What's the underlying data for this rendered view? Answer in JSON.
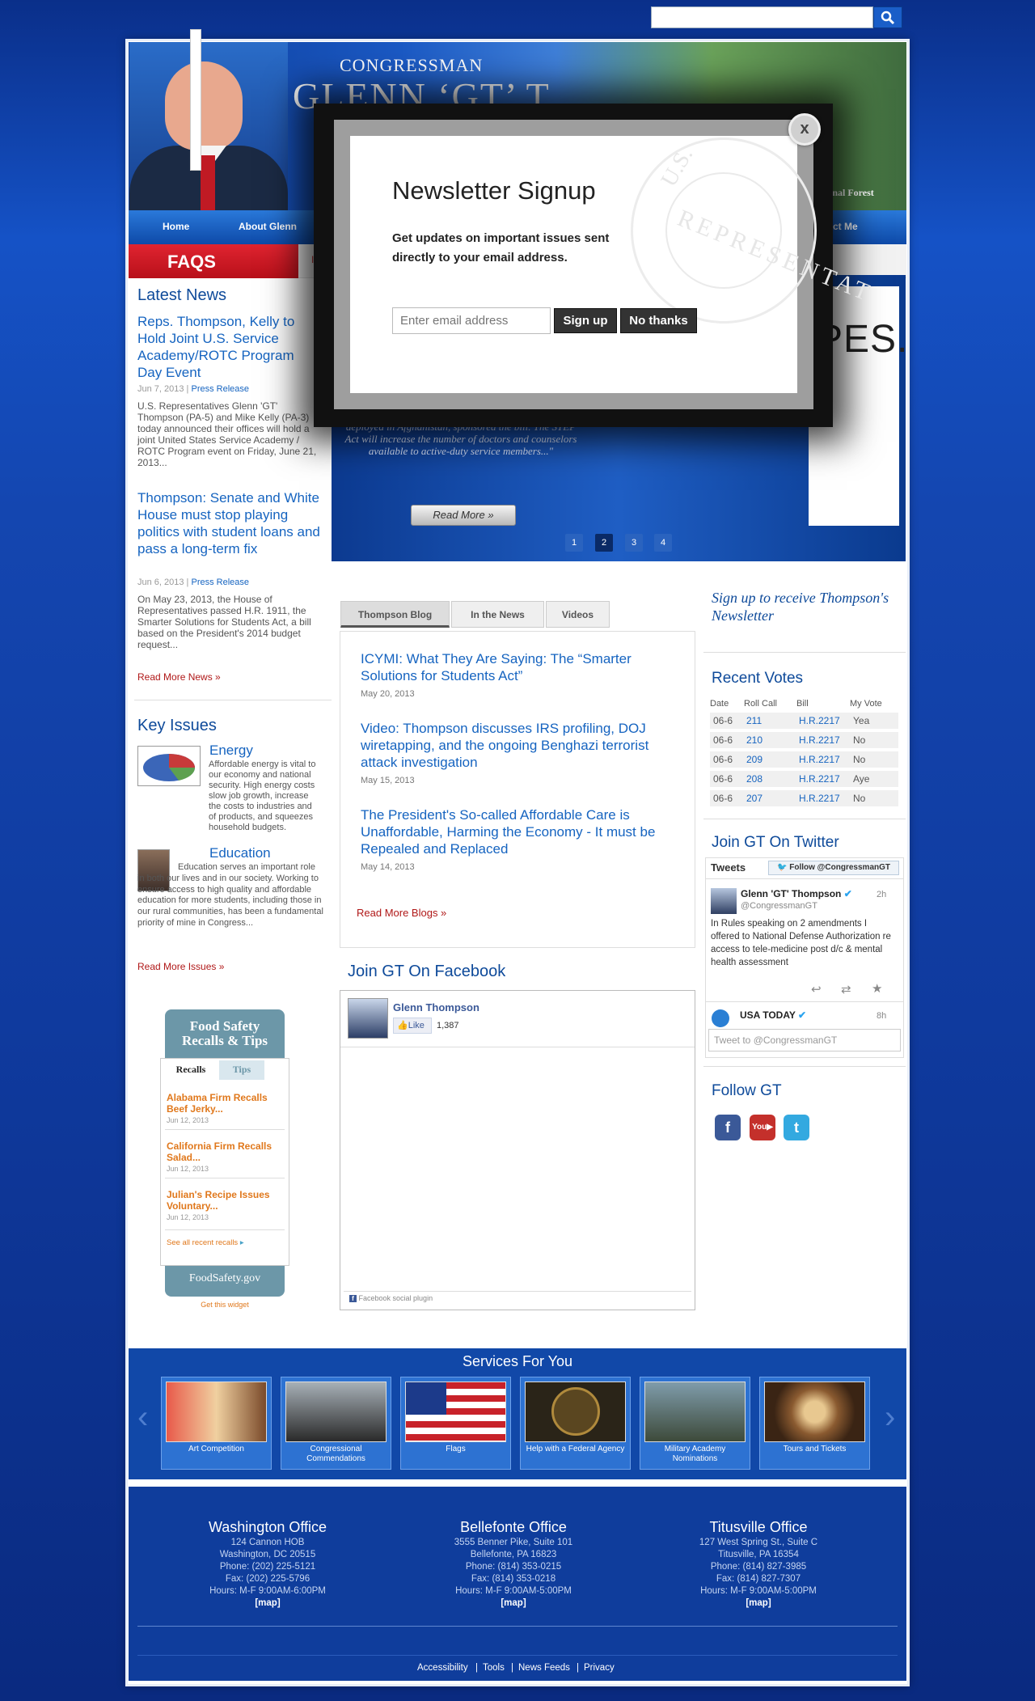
{
  "search": {
    "placeholder": ""
  },
  "header": {
    "title_small": "CONGRESSMAN",
    "title_big": "GLENN ‘GT’ T",
    "forest_caption": "ational Forest",
    "nav": [
      "Home",
      "About Glenn",
      "ntact Me"
    ],
    "faqs": "FAQS",
    "faqs_partial": "Int"
  },
  "latest_news": {
    "heading": "Latest News",
    "items": [
      {
        "title": "Reps. Thompson, Kelly to Hold Joint U.S. Service Academy/ROTC Program Day Event",
        "date": "Jun 7, 2013",
        "category": "Press Release",
        "snippet": "U.S. Representatives Glenn 'GT' Thompson (PA-5) and Mike Kelly (PA-3) today announced their offices will hold a joint United States Service Academy / ROTC Program event on Friday, June 21, 2013..."
      },
      {
        "title": "Thompson: Senate and White House must stop playing politics with student loans and pass a long-term fix",
        "date": "Jun 6, 2013",
        "category": "Press Release",
        "snippet": "On May 23, 2013, the House of Representatives passed H.R. 1911, the Smarter Solutions for Students Act, a bill based on the President's 2014 budget request..."
      }
    ],
    "more": "Read More News »"
  },
  "key_issues": {
    "heading": "Key Issues",
    "items": [
      {
        "title": "Energy",
        "text": "Affordable energy is vital to our economy and national security. High energy costs slow job growth, increase the costs to industries and of products, and squeezes household budgets."
      },
      {
        "title": "Education",
        "text": "Education serves an important role in both our lives and in our society. Working to ensure access to high quality and affordable education for more students, including those in our rural communities, has been a fundamental priority of mine in Congress..."
      }
    ],
    "more": "Read More Issues »"
  },
  "food_safety": {
    "title": "Food Safety Recalls & Tips",
    "tabs": [
      "Recalls",
      "Tips"
    ],
    "items": [
      {
        "title": "Alabama Firm Recalls Beef Jerky...",
        "date": "Jun 12, 2013"
      },
      {
        "title": "California Firm Recalls Salad...",
        "date": "Jun 12, 2013"
      },
      {
        "title": "Julian's Recipe Issues Voluntary...",
        "date": "Jun 12, 2013"
      }
    ],
    "see_all": "See all recent recalls",
    "footer": "FoodSafety.gov",
    "get_widget": "Get this widget"
  },
  "slider": {
    "partial_text": "PES.",
    "quote": "Thompson, R-Pa., father of an Army staff sergeant deployed in Afghanistan, sponsored the bill. The STEP Act will increase the number of doctors and counselors available to active-duty service members...\"",
    "read_more": "Read More »",
    "pages": [
      "1",
      "2",
      "3",
      "4"
    ],
    "active_page": 2
  },
  "blog": {
    "tabs": [
      "Thompson Blog",
      "In the News",
      "Videos"
    ],
    "items": [
      {
        "title": "ICYMI: What They Are Saying: The “Smarter Solutions for Students Act”",
        "date": "May 20, 2013"
      },
      {
        "title": "Video: Thompson discusses IRS profiling, DOJ wiretapping, and the ongoing Benghazi terrorist attack investigation",
        "date": "May 15, 2013"
      },
      {
        "title": "The President's So-called Affordable Care is Unaffordable, Harming the Economy - It must be Repealed and Replaced",
        "date": "May 14, 2013"
      }
    ],
    "more": "Read More Blogs »"
  },
  "facebook": {
    "heading": "Join GT On Facebook",
    "name": "Glenn Thompson",
    "like": "Like",
    "count": "1,387",
    "plugin": "Facebook social plugin"
  },
  "right": {
    "newsletter": "Sign up to receive Thompson's Newsletter",
    "votes_heading": "Recent Votes",
    "votes_cols": [
      "Date",
      "Roll Call",
      "Bill",
      "My Vote"
    ],
    "votes": [
      {
        "date": "06-6",
        "roll": "211",
        "bill": "H.R.2217",
        "vote": "Yea"
      },
      {
        "date": "06-6",
        "roll": "210",
        "bill": "H.R.2217",
        "vote": "No"
      },
      {
        "date": "06-6",
        "roll": "209",
        "bill": "H.R.2217",
        "vote": "No"
      },
      {
        "date": "06-6",
        "roll": "208",
        "bill": "H.R.2217",
        "vote": "Aye"
      },
      {
        "date": "06-6",
        "roll": "207",
        "bill": "H.R.2217",
        "vote": "No"
      }
    ],
    "twitter_heading": "Join GT On Twitter",
    "tweets_label": "Tweets",
    "follow": "Follow @CongressmanGT",
    "tweet1": {
      "name": "Glenn 'GT' Thompson",
      "handle": "@CongressmanGT",
      "time": "2h",
      "text": "In Rules speaking on 2 amendments I offered to National Defense Authorization re access to tele-medicine post d/c & mental health assessment"
    },
    "tweet2": {
      "name": "USA TODAY",
      "time": "8h"
    },
    "tweet_placeholder": "Tweet to @CongressmanGT",
    "follow_heading": "Follow GT",
    "social": [
      "facebook-icon",
      "youtube-icon",
      "twitter-icon"
    ]
  },
  "services": {
    "heading": "Services For You",
    "items": [
      "Art Competition",
      "Congressional Commendations",
      "Flags",
      "Help with a Federal Agency",
      "Military Academy Nominations",
      "Tours and Tickets"
    ]
  },
  "offices": [
    {
      "name": "Washington Office",
      "lines": [
        "124 Cannon HOB",
        "Washington, DC 20515",
        "Phone: (202) 225-5121",
        "Fax: (202) 225-5796",
        "Hours: M-F 9:00AM-6:00PM"
      ],
      "map": "[map]"
    },
    {
      "name": "Bellefonte Office",
      "lines": [
        "3555 Benner Pike, Suite 101",
        "Bellefonte, PA 16823",
        "Phone: (814) 353-0215",
        "Fax: (814) 353-0218",
        "Hours: M-F 9:00AM-5:00PM"
      ],
      "map": "[map]"
    },
    {
      "name": "Titusville Office",
      "lines": [
        "127 West Spring St., Suite C",
        "Titusville, PA 16354",
        "Phone: (814) 827-3985",
        "Fax: (814) 827-7307",
        "Hours: M-F 9:00AM-5:00PM"
      ],
      "map": "[map]"
    }
  ],
  "footer_links": [
    "Accessibility",
    "Tools",
    "News Feeds",
    "Privacy"
  ],
  "modal": {
    "title": "Newsletter Signup",
    "text": "Get updates on important issues sent directly to your email address.",
    "email_placeholder": "Enter email address",
    "signup": "Sign up",
    "no_thanks": "No thanks",
    "close": "x",
    "seal_text": "REPRESENTAT",
    "seal_top": "U.S."
  },
  "colors": {
    "brand_blue": "#0e4a9a",
    "link_blue": "#1664c0",
    "faq_red": "#d0202a",
    "recall_orange": "#e0781c"
  }
}
